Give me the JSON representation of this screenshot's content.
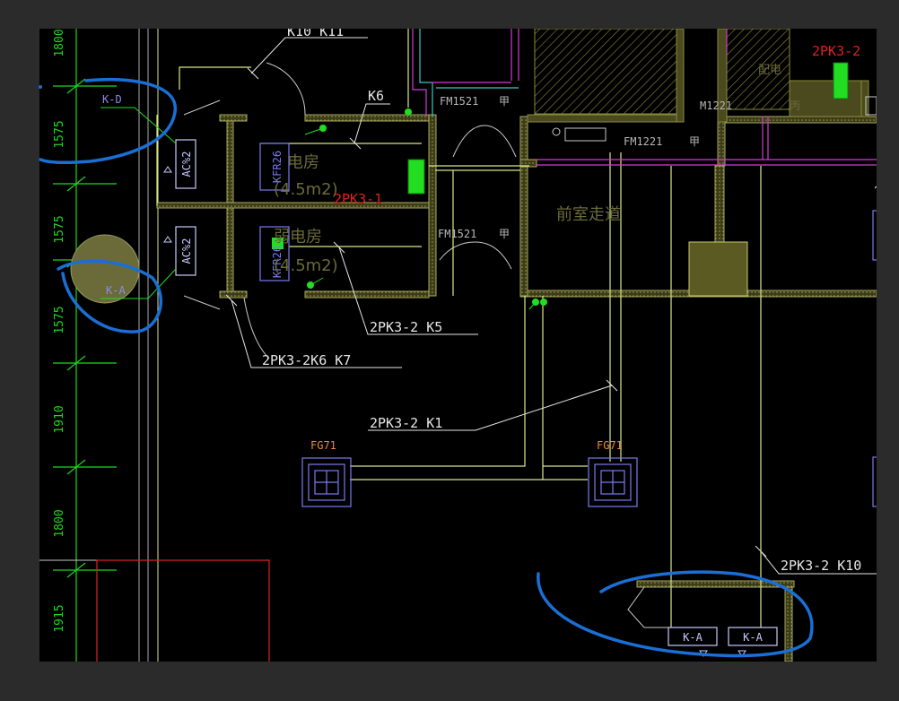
{
  "colors": {
    "frame": "#2b2b2b",
    "canvas": "#000000",
    "wall": "#4a4a1e",
    "wall_hatch": "#8a8a3a",
    "duct_yellow": "#d8e88a",
    "magenta": "#d23cd2",
    "cyan": "#38c8c8",
    "green_dim": "#1fd71f",
    "blue_unit": "#7a7af0",
    "red": "#e02020",
    "orange": "#e88a3a",
    "leader": "#e6e6e6",
    "highlight": "#1a6fd6",
    "chinese": "#6a6a3a",
    "fill_green": "#22dd22"
  },
  "dimensions": [
    "1800",
    "1575",
    "1575",
    "1575",
    "1910",
    "1800",
    "1915"
  ],
  "labels": {
    "k10_k11": "K10 K11",
    "k6": "K6",
    "fm1521_top": "FM1521",
    "fm1521_top_grade": "甲",
    "fm1221": "FM1221",
    "fm1221_grade": "甲",
    "fm1521_mid": "FM1521",
    "fm1521_mid_grade": "甲",
    "corridor": "前室走道",
    "room_top": "电房",
    "room_top_area": "(4.5m2)",
    "room_mid": "弱电房",
    "room_mid_area": "(4.5m2)",
    "room_top_right": "配电",
    "room_top_right_b": "丙",
    "m1221": "M1221",
    "pk3_1": "2PK3-1",
    "pk_top_right": "2PK3-2",
    "kd": "K-D",
    "ka_left": "K-A",
    "ac_top": "AC%2",
    "ac_mid": "AC%2",
    "kfr_top": "KFR26",
    "kfr_mid": "KFR26",
    "pk3_2_k5": "2PK3-2 K5",
    "pk3_2k6_k7": "2PK3-2K6 K7",
    "pk3_2_k1": "2PK3-2 K1",
    "fg71_left": "FG71",
    "fg71_right": "FG71",
    "pk3_2_k10": "2PK3-2 K10",
    "ka_bottom_1": "K-A",
    "ka_bottom_2": "K-A"
  }
}
